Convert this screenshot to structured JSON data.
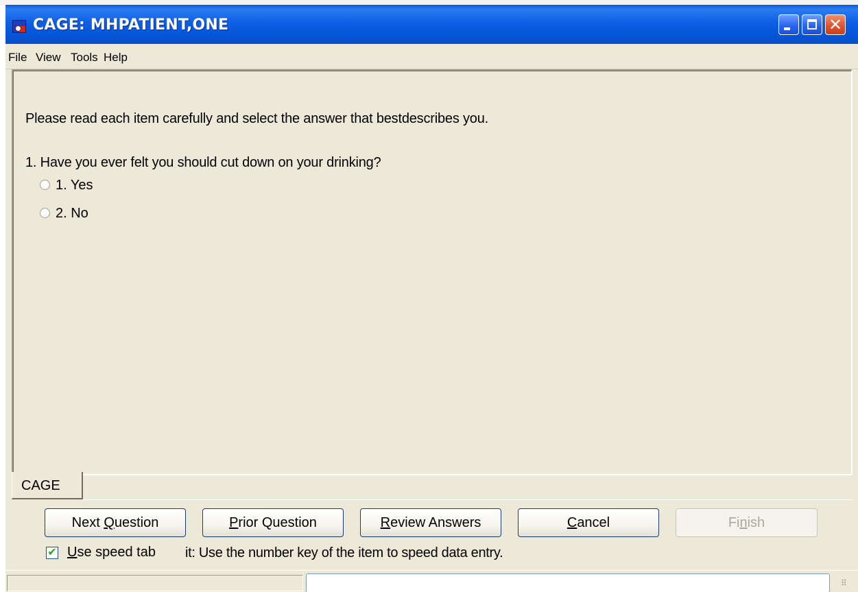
{
  "window": {
    "title": "CAGE: MHPATIENT,ONE",
    "controls": {
      "minimize": "minimize-icon",
      "maximize": "maximize-icon",
      "close": "close-icon"
    }
  },
  "menu": {
    "items": [
      "File",
      "View",
      "Tools",
      "Help"
    ]
  },
  "instructions": "Please read each item carefully and select the answer that bestdescribes you.",
  "question": {
    "text": "1. Have you ever felt you should cut down on your drinking?",
    "options": [
      {
        "label": "1. Yes",
        "selected": false
      },
      {
        "label": "2. No",
        "selected": false
      }
    ]
  },
  "tabs": [
    {
      "label": "CAGE",
      "active": true
    }
  ],
  "buttons": {
    "next": {
      "pre": "Next ",
      "ul": "Q",
      "post": "uestion"
    },
    "prior": {
      "pre": "",
      "ul": "P",
      "post": "rior Question"
    },
    "review": {
      "pre": "",
      "ul": "R",
      "post": "eview Answers"
    },
    "cancel": {
      "pre": "",
      "ul": "C",
      "post": "ancel"
    },
    "finish": {
      "pre": "Fi",
      "ul": "n",
      "post": "ish",
      "enabled": false
    }
  },
  "speed_tab": {
    "checked": true,
    "label_ul": "U",
    "label_rest": "se speed tab"
  },
  "hint": "it: Use the number key of the item to speed data entry.",
  "colors": {
    "titlebar": "#0454d6",
    "background": "#ece9d8",
    "checkmark": "#2aa028"
  }
}
